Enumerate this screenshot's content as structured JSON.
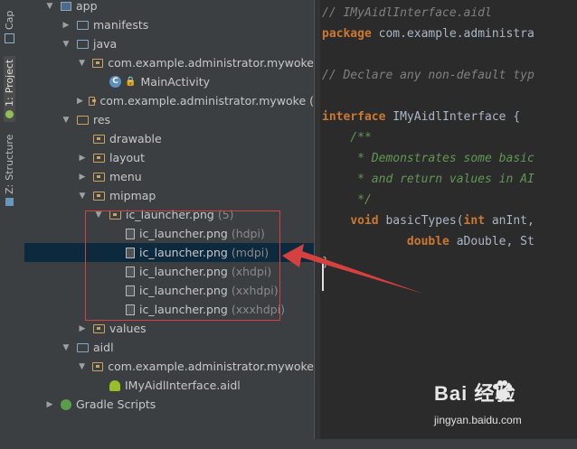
{
  "toolstrip": {
    "tabs": [
      {
        "label": "Cap",
        "key": ""
      },
      {
        "label": "Project",
        "key": "1:"
      },
      {
        "label": "Structure",
        "key": "Z:"
      }
    ]
  },
  "tree": {
    "rows": [
      {
        "label": "app",
        "indent": 0,
        "arrow": "▼",
        "icon": "module"
      },
      {
        "label": "manifests",
        "indent": 1,
        "arrow": "▶",
        "icon": "folder"
      },
      {
        "label": "java",
        "indent": 1,
        "arrow": "▼",
        "icon": "folder"
      },
      {
        "label": "com.example.administrator.mywoke",
        "indent": 2,
        "arrow": "▼",
        "icon": "package"
      },
      {
        "label": "MainActivity",
        "indent": 3,
        "arrow": "",
        "icon": "class"
      },
      {
        "label": "com.example.administrator.mywoke (",
        "indent": 2,
        "arrow": "▶",
        "icon": "package"
      },
      {
        "label": "res",
        "indent": 1,
        "arrow": "▼",
        "icon": "res"
      },
      {
        "label": "drawable",
        "indent": 2,
        "arrow": "",
        "icon": "package"
      },
      {
        "label": "layout",
        "indent": 2,
        "arrow": "▶",
        "icon": "package"
      },
      {
        "label": "menu",
        "indent": 2,
        "arrow": "▶",
        "icon": "package"
      },
      {
        "label": "mipmap",
        "indent": 2,
        "arrow": "▼",
        "icon": "package"
      },
      {
        "label": "ic_launcher.png",
        "hint": "(5)",
        "indent": 3,
        "arrow": "▼",
        "icon": "package"
      },
      {
        "label": "ic_launcher.png",
        "hint": "(hdpi)",
        "indent": 4,
        "arrow": "",
        "icon": "file"
      },
      {
        "label": "ic_launcher.png",
        "hint": "(mdpi)",
        "indent": 4,
        "arrow": "",
        "icon": "file"
      },
      {
        "label": "ic_launcher.png",
        "hint": "(xhdpi)",
        "indent": 4,
        "arrow": "",
        "icon": "file"
      },
      {
        "label": "ic_launcher.png",
        "hint": "(xxhdpi)",
        "indent": 4,
        "arrow": "",
        "icon": "file"
      },
      {
        "label": "ic_launcher.png",
        "hint": "(xxxhdpi)",
        "indent": 4,
        "arrow": "",
        "icon": "file"
      },
      {
        "label": "values",
        "indent": 2,
        "arrow": "▶",
        "icon": "package"
      },
      {
        "label": "aidl",
        "indent": 1,
        "arrow": "▼",
        "icon": "folder"
      },
      {
        "label": "com.example.administrator.mywoke",
        "indent": 2,
        "arrow": "▼",
        "icon": "package"
      },
      {
        "label": "IMyAidlInterface.aidl",
        "indent": 3,
        "arrow": "",
        "icon": "android"
      },
      {
        "label": "Gradle Scripts",
        "indent": 0,
        "arrow": "▶",
        "icon": "gradle"
      }
    ],
    "selected_index": 13
  },
  "editor": {
    "lines": [
      {
        "segs": [
          {
            "t": "// IMyAidlInterface.aidl",
            "c": "cm"
          }
        ]
      },
      {
        "segs": [
          {
            "t": "package",
            "c": "kw"
          },
          {
            "t": " com.example.administra",
            "c": ""
          }
        ]
      },
      {
        "segs": [
          {
            "t": "",
            "c": ""
          }
        ]
      },
      {
        "segs": [
          {
            "t": "// Declare any non-default typ",
            "c": "cm"
          }
        ]
      },
      {
        "segs": [
          {
            "t": "",
            "c": ""
          }
        ]
      },
      {
        "segs": [
          {
            "t": "interface",
            "c": "kw"
          },
          {
            "t": " IMyAidlInterface {",
            "c": ""
          }
        ]
      },
      {
        "segs": [
          {
            "t": "    /**",
            "c": "jd"
          }
        ]
      },
      {
        "segs": [
          {
            "t": "     * Demonstrates some basic",
            "c": "jd"
          }
        ]
      },
      {
        "segs": [
          {
            "t": "     * and return values in AI",
            "c": "jd"
          }
        ]
      },
      {
        "segs": [
          {
            "t": "     */",
            "c": "jd"
          }
        ]
      },
      {
        "segs": [
          {
            "t": "    ",
            "c": ""
          },
          {
            "t": "void",
            "c": "kw"
          },
          {
            "t": " basicTypes(",
            "c": ""
          },
          {
            "t": "int",
            "c": "kw"
          },
          {
            "t": " anInt,",
            "c": ""
          }
        ]
      },
      {
        "segs": [
          {
            "t": "            ",
            "c": ""
          },
          {
            "t": "double",
            "c": "kw"
          },
          {
            "t": " aDouble, St",
            "c": ""
          }
        ]
      },
      {
        "segs": [
          {
            "t": "}",
            "c": ""
          }
        ]
      }
    ]
  },
  "watermark": {
    "main": "Bai  经验",
    "sub": "jingyan.baidu.com"
  }
}
